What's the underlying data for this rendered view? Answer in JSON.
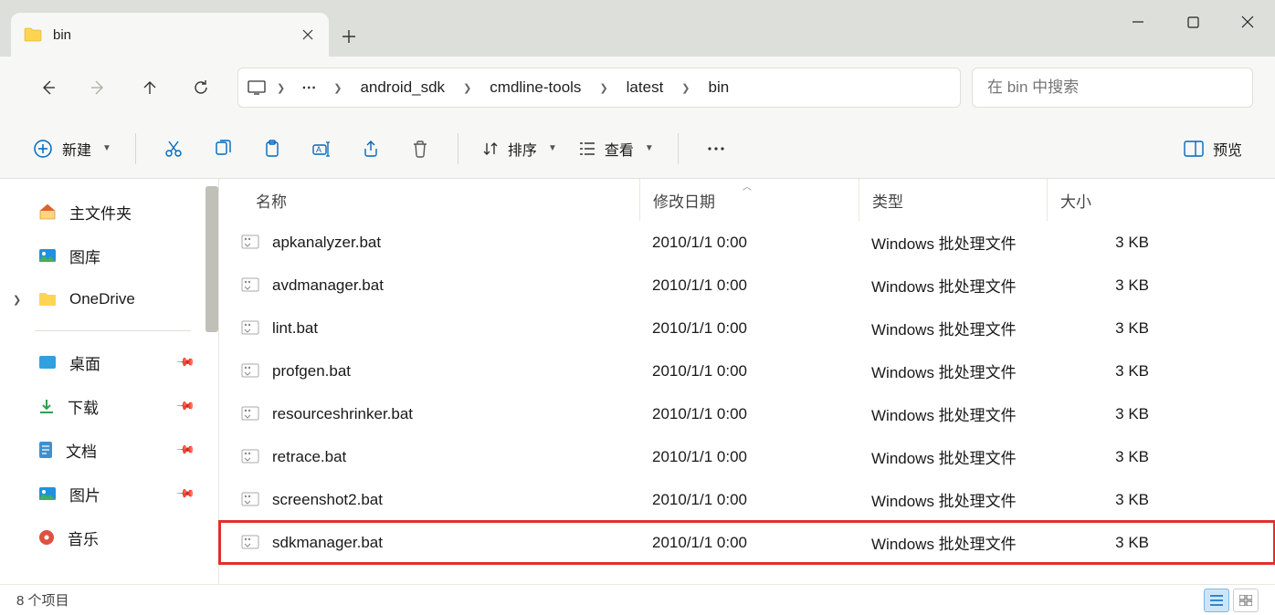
{
  "tab": {
    "title": "bin"
  },
  "breadcrumb": {
    "segments": [
      "android_sdk",
      "cmdline-tools",
      "latest",
      "bin"
    ]
  },
  "search": {
    "placeholder": "在 bin 中搜索"
  },
  "toolbar": {
    "new_label": "新建",
    "sort_label": "排序",
    "view_label": "查看",
    "preview_label": "预览"
  },
  "sidebar": {
    "items": [
      {
        "label": "主文件夹",
        "icon": "home"
      },
      {
        "label": "图库",
        "icon": "gallery"
      },
      {
        "label": "OneDrive",
        "icon": "onedrive",
        "expandable": true
      }
    ],
    "quick": [
      {
        "label": "桌面",
        "icon": "desktop"
      },
      {
        "label": "下载",
        "icon": "downloads"
      },
      {
        "label": "文档",
        "icon": "documents"
      },
      {
        "label": "图片",
        "icon": "pictures"
      },
      {
        "label": "音乐",
        "icon": "music"
      }
    ]
  },
  "columns": {
    "name": "名称",
    "date": "修改日期",
    "type": "类型",
    "size": "大小"
  },
  "files": [
    {
      "name": "apkanalyzer.bat",
      "date": "2010/1/1 0:00",
      "type": "Windows 批处理文件",
      "size": "3 KB",
      "highlighted": false
    },
    {
      "name": "avdmanager.bat",
      "date": "2010/1/1 0:00",
      "type": "Windows 批处理文件",
      "size": "3 KB",
      "highlighted": false
    },
    {
      "name": "lint.bat",
      "date": "2010/1/1 0:00",
      "type": "Windows 批处理文件",
      "size": "3 KB",
      "highlighted": false
    },
    {
      "name": "profgen.bat",
      "date": "2010/1/1 0:00",
      "type": "Windows 批处理文件",
      "size": "3 KB",
      "highlighted": false
    },
    {
      "name": "resourceshrinker.bat",
      "date": "2010/1/1 0:00",
      "type": "Windows 批处理文件",
      "size": "3 KB",
      "highlighted": false
    },
    {
      "name": "retrace.bat",
      "date": "2010/1/1 0:00",
      "type": "Windows 批处理文件",
      "size": "3 KB",
      "highlighted": false
    },
    {
      "name": "screenshot2.bat",
      "date": "2010/1/1 0:00",
      "type": "Windows 批处理文件",
      "size": "3 KB",
      "highlighted": false
    },
    {
      "name": "sdkmanager.bat",
      "date": "2010/1/1 0:00",
      "type": "Windows 批处理文件",
      "size": "3 KB",
      "highlighted": true
    }
  ],
  "status": {
    "item_count": "8 个项目"
  }
}
